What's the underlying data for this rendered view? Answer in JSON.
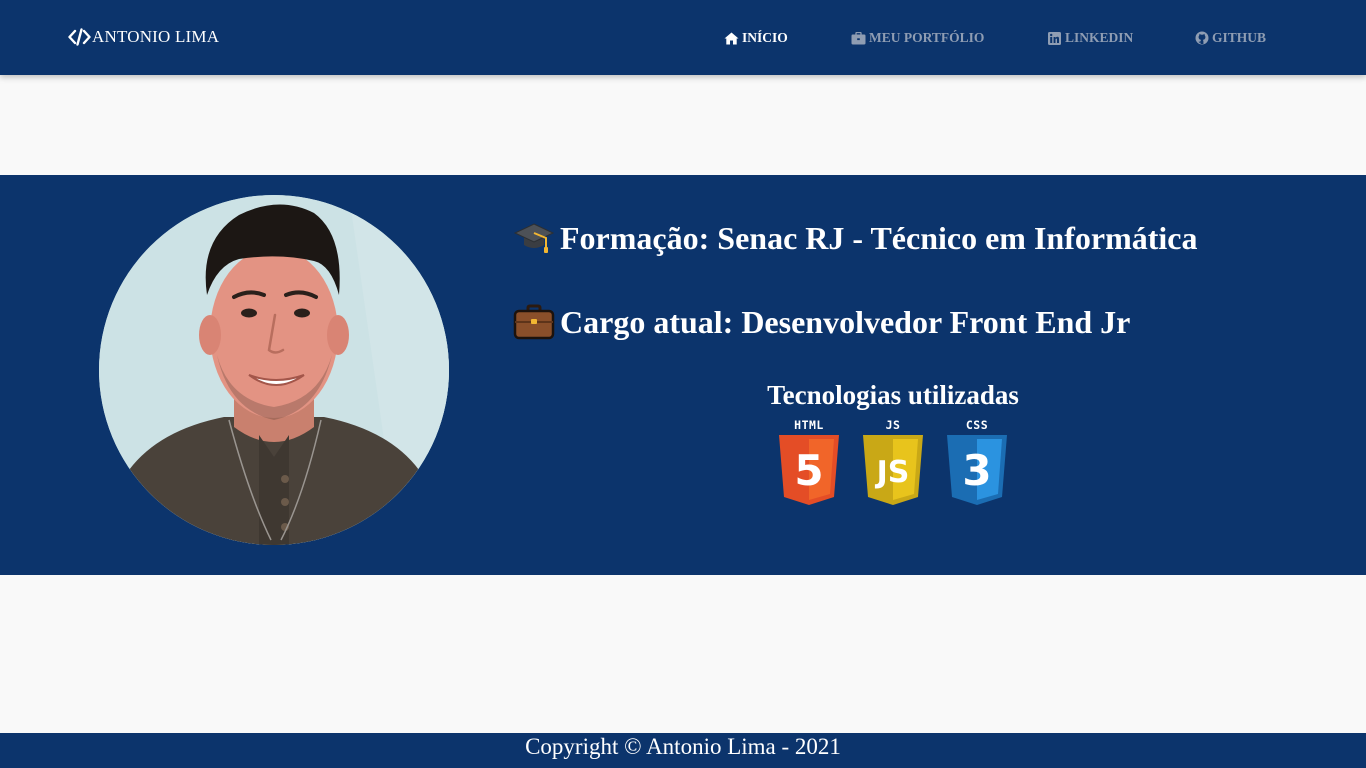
{
  "brand": {
    "label": "ANTONIO LIMA",
    "icon": "code-icon"
  },
  "nav": {
    "items": [
      {
        "label": "INÍCIO",
        "icon": "home-icon",
        "active": true
      },
      {
        "label": "MEU PORTFÓLIO",
        "icon": "briefcase-icon",
        "active": false
      },
      {
        "label": "LINKEDIN",
        "icon": "linkedin-icon",
        "active": false
      },
      {
        "label": "GITHUB",
        "icon": "github-icon",
        "active": false
      }
    ]
  },
  "profile": {
    "photo": "profile-photo",
    "formacao": "Formação: Senac RJ - Técnico em Informática",
    "formacao_icon": "graduation-cap-icon",
    "cargo": "Cargo atual: Desenvolvedor Front End Jr",
    "cargo_icon": "briefcase-emoji-icon"
  },
  "technologies": {
    "title": "Tecnologias utilizadas",
    "items": [
      {
        "label": "HTML",
        "glyph": "5",
        "color": "#e44d26"
      },
      {
        "label": "JS",
        "glyph": "JS",
        "color": "#e8c41c"
      },
      {
        "label": "CSS",
        "glyph": "3",
        "color": "#1e76c0"
      }
    ]
  },
  "footer": {
    "copyright": "Copyright © Antonio Lima - 2021"
  },
  "colors": {
    "primary": "#0c346c",
    "background": "#f9f9f9",
    "nav_inactive": "#8f9db3"
  }
}
